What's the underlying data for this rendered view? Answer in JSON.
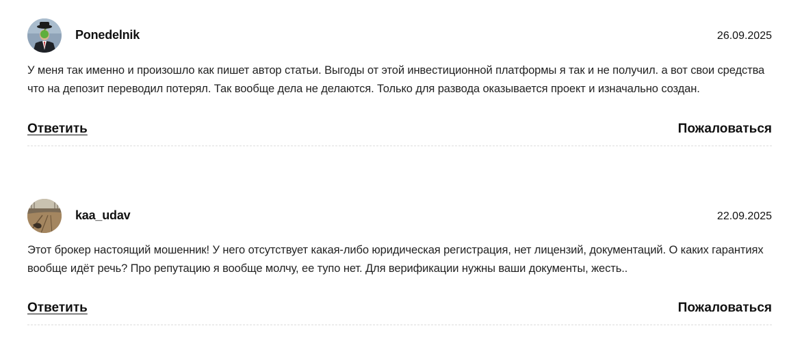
{
  "comments": [
    {
      "author": "Ponedelnik",
      "date": "26.09.2025",
      "avatar_icon": "man-with-green-apple-avatar",
      "text": "У меня так именно и произошло как пишет автор статьи. Выгоды от этой инвестиционной платформы я так и не получил. а вот свои средства что на депозит переводил потерял. Так вообще дела не делаются. Только для развода оказывается проект и изначально создан.",
      "reply_label": "Ответить",
      "complain_label": "Пожаловаться"
    },
    {
      "author": "kaa_udav",
      "date": "22.09.2025",
      "avatar_icon": "field-landscape-avatar",
      "text": "Этот брокер настоящий мошенник! У него отсутствует какая-либо юридическая регистрация, нет лицензий, документаций. О каких гарантиях вообще идёт речь? Про репутацию я вообще молчу, ее тупо нет. Для верификации нужны ваши документы, жесть..",
      "reply_label": "Ответить",
      "complain_label": "Пожаловаться"
    }
  ],
  "colors": {
    "text": "#1a1a1a",
    "divider": "#dcdcdc",
    "background": "#ffffff"
  }
}
